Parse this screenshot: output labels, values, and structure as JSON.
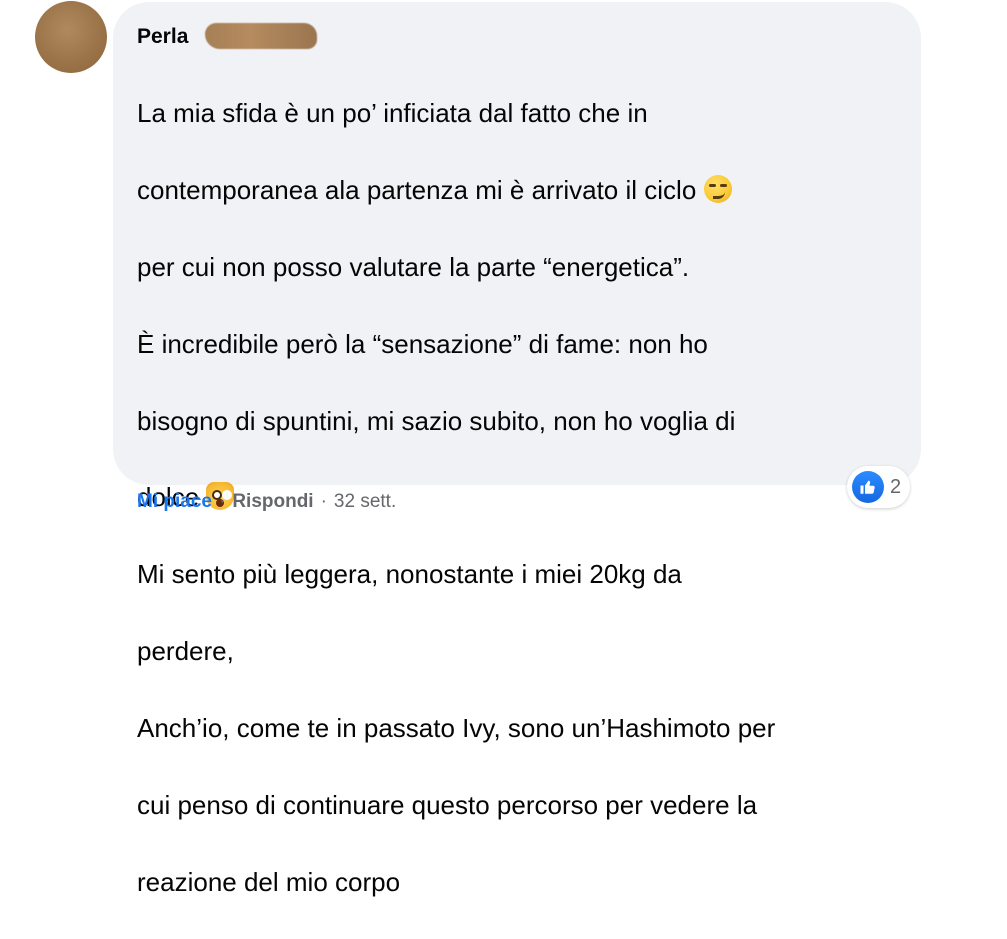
{
  "comment": {
    "author": "Perla",
    "lines": [
      "La mia sfida è un po’ inficiata dal fatto che in",
      "contemporanea ala partenza mi è arrivato il ciclo",
      "per cui non posso valutare la parte “energetica”.",
      "È incredibile però la “sensazione” di fame: non ho",
      "bisogno di spuntini, mi sazio subito, non ho voglia di",
      "dolce",
      "Mi sento più leggera, nonostante i miei 20kg da",
      "perdere,",
      "Anch’io, come te in passato Ivy, sono un’Hashimoto per",
      "cui penso di continuare questo percorso per vedere la",
      "reazione del mio corpo"
    ],
    "emoji": [
      "smirking-face",
      "weary-cat-face"
    ]
  },
  "actions": {
    "like_label": "Mi piace",
    "separator": "·",
    "reply_label": "Rispondi",
    "timestamp": "32 sett."
  },
  "reactions": {
    "icon": "like-thumb-icon",
    "count": "2",
    "color": "#1877f2"
  },
  "colors": {
    "bubble": "#f0f2f5",
    "text": "#050505",
    "secondary": "#65676b",
    "accent": "#1877f2"
  }
}
